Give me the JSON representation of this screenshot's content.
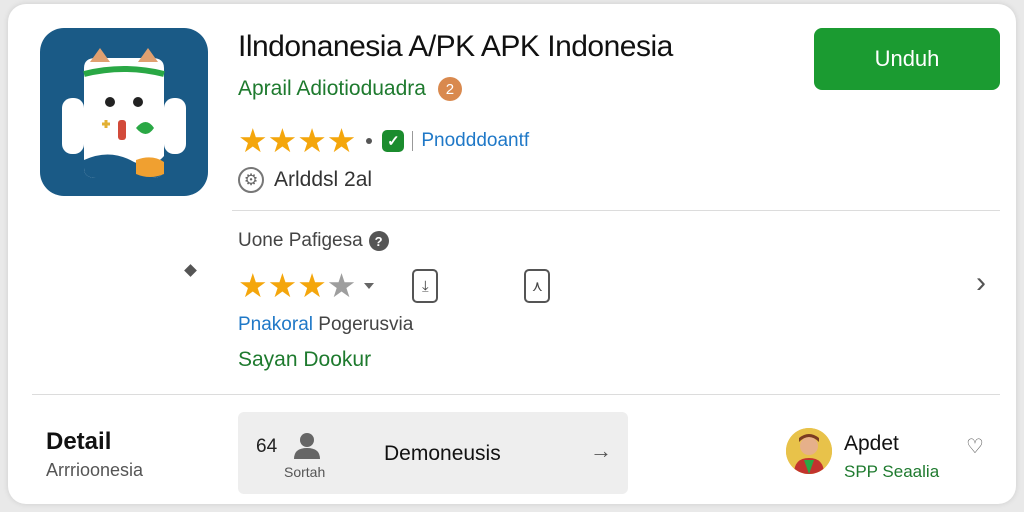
{
  "app": {
    "title": "Ilndonanesia A/PK APK Indonesia",
    "developer": "Aprail Adiotioduadra",
    "dev_badge": "2",
    "rating_stars": 4,
    "category_link": "Pnodddoantf",
    "version": "Arlddsl 2al",
    "install_label": "Unduh",
    "colors": {
      "accent_green": "#1b9b31",
      "icon_bg": "#1a5a86",
      "star": "#f4a60c",
      "link": "#1f78c7"
    }
  },
  "reviews": {
    "label": "Uone Pafigesa",
    "help_icon": "?",
    "rating_stars": 3,
    "permission_prefix": "Pnakoral",
    "permission_text": "Pogerusvia",
    "safety_text": "Sayan Dookur"
  },
  "details": {
    "title": "Detail",
    "subtitle": "Arrrioonesia",
    "chip": {
      "count": "64",
      "sub": "Sortah",
      "text": "Demoneusis",
      "arrow": "→"
    },
    "update": {
      "title": "Apdet",
      "subtitle": "SPP Seaalia"
    }
  },
  "icons": {
    "dev_badge": "badge-icon",
    "verified": "check-icon",
    "version": "gear-icon",
    "help": "help-icon",
    "phone": "phone-icon",
    "share": "share-icon",
    "next": "chevron-right-icon",
    "person": "person-icon",
    "favorite": "heart-icon"
  }
}
